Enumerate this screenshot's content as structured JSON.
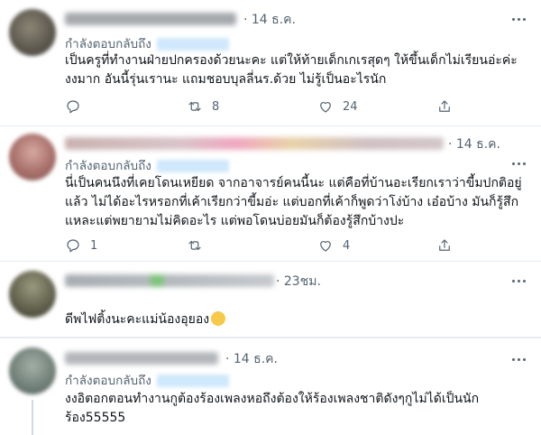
{
  "tweets": [
    {
      "date": "· 14 ธ.ค.",
      "reply_prefix": "กำลังตอบกลับถึง",
      "text": "เป็นครูที่ทำงานฝ่ายปกครองด้วยนะคะ แต่ให้ท้ายเด็กเกเรสุดๆ ให้ขึ้นเด็กไม่เรียนอ่ะค่ะ\nงงมาก อันนี้รุ่นเรานะ  แถมชอบบุลลี่นร.ด้วย ไม่รู้เป็นอะไรนัก",
      "actions": {
        "reply": "",
        "retweet": "8",
        "like": "24"
      },
      "colors": {
        "avatar": "#6e6a60",
        "name": "#9aa0a6"
      }
    },
    {
      "date": "· 14 ธ.ค.",
      "reply_prefix": "กำลังตอบกลับถึง",
      "text": "นี่เป็นคนนึงที่เคยโดนเหยียด จากอาจารย์คนนี้นะ แต่คือที่บ้านอะเรียกเราว่าขี้มปกติอยู่\nแล้ว ไม่ได้อะไรหรอกที่เค้าเรียกว่าขี้มอ่ะ แต่บอกที่เค้าก็พูดว่าโง่บ้าง เอ๋อบ้าง มันก็รู้สึก\nแหละแต่พยายามไม่คิดอะไร แต่พอโดนบ่อยมันก็ต้องรู้สึกบ้างปะ",
      "actions": {
        "reply": "1",
        "retweet": "",
        "like": "4"
      },
      "colors": {
        "avatar": "#b98a86",
        "name": "#e8a0b4"
      }
    },
    {
      "date": "· 23ชม.",
      "reply_prefix": "",
      "text": "ดีพไฟติ้งนะคะแม่น้องอุยอง",
      "actions": {
        "reply": "",
        "retweet": "",
        "like": ""
      },
      "colors": {
        "avatar": "#6b6a52",
        "name": "#9aa0a6"
      }
    },
    {
      "date": "· 14 ธ.ค.",
      "reply_prefix": "กำลังตอบกลับถึง",
      "text": "งงอิตอกตอนทำงานกูต้องร้องเพลงหอถึงต้องให้ร้องเพลงชาติดังๆกูไม่ได้เป็นนัก\nร้อง55555",
      "actions": {
        "reply": "",
        "retweet": "",
        "like": ""
      },
      "colors": {
        "avatar": "#7a8a80",
        "name": "#9aa0a6"
      }
    }
  ],
  "icons": [
    "reply-icon",
    "retweet-icon",
    "like-icon",
    "share-icon",
    "more-icon"
  ]
}
